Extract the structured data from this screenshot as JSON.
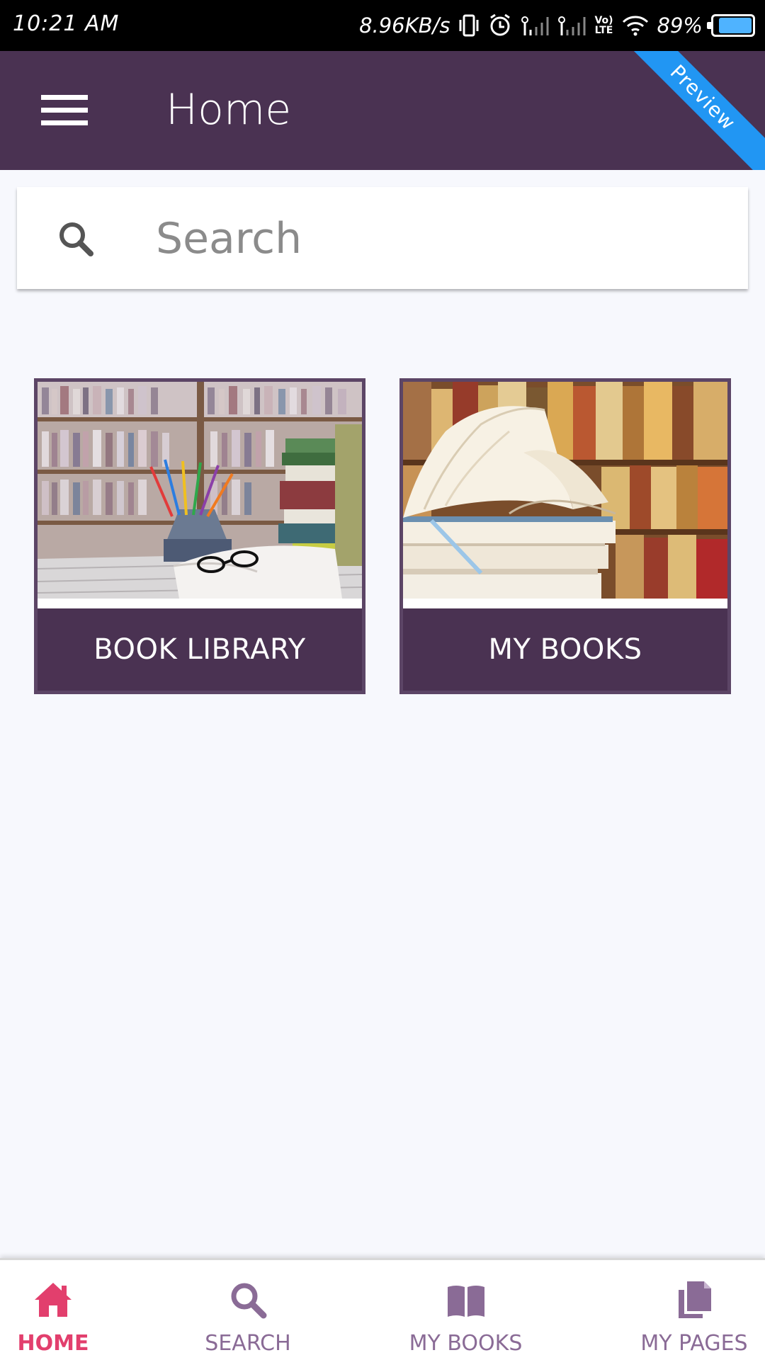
{
  "status_bar": {
    "time": "10:21 AM",
    "network_speed": "8.96KB/s",
    "lte_label": "Vo)\nLTE",
    "battery": "89%",
    "battery_level": 0.89,
    "icons": [
      "vibrate-icon",
      "alarm-icon",
      "signal-icon",
      "signal-icon",
      "volte-icon",
      "wifi-icon",
      "battery-icon"
    ]
  },
  "app_bar": {
    "title": "Home",
    "ribbon": "Preview",
    "menu_icon": "hamburger-menu-icon",
    "background": "#4a3252",
    "ribbon_color": "#2196f3"
  },
  "search": {
    "placeholder": "Search",
    "icon": "search-icon"
  },
  "tiles": [
    {
      "label": "BOOK LIBRARY",
      "image": "bookshelf-with-pencils-and-glasses-photo"
    },
    {
      "label": "MY BOOKS",
      "image": "open-book-on-stack-photo"
    }
  ],
  "bottom_nav": {
    "items": [
      {
        "label": "HOME",
        "icon": "home-icon",
        "active": true,
        "color": "#e23f6d"
      },
      {
        "label": "SEARCH",
        "icon": "search-icon",
        "active": false,
        "color": "#8a6b96"
      },
      {
        "label": "MY BOOKS",
        "icon": "book-open-icon",
        "active": false,
        "color": "#8a6b96"
      },
      {
        "label": "MY PAGES",
        "icon": "pages-copy-icon",
        "active": false,
        "color": "#8a6b96"
      }
    ]
  }
}
